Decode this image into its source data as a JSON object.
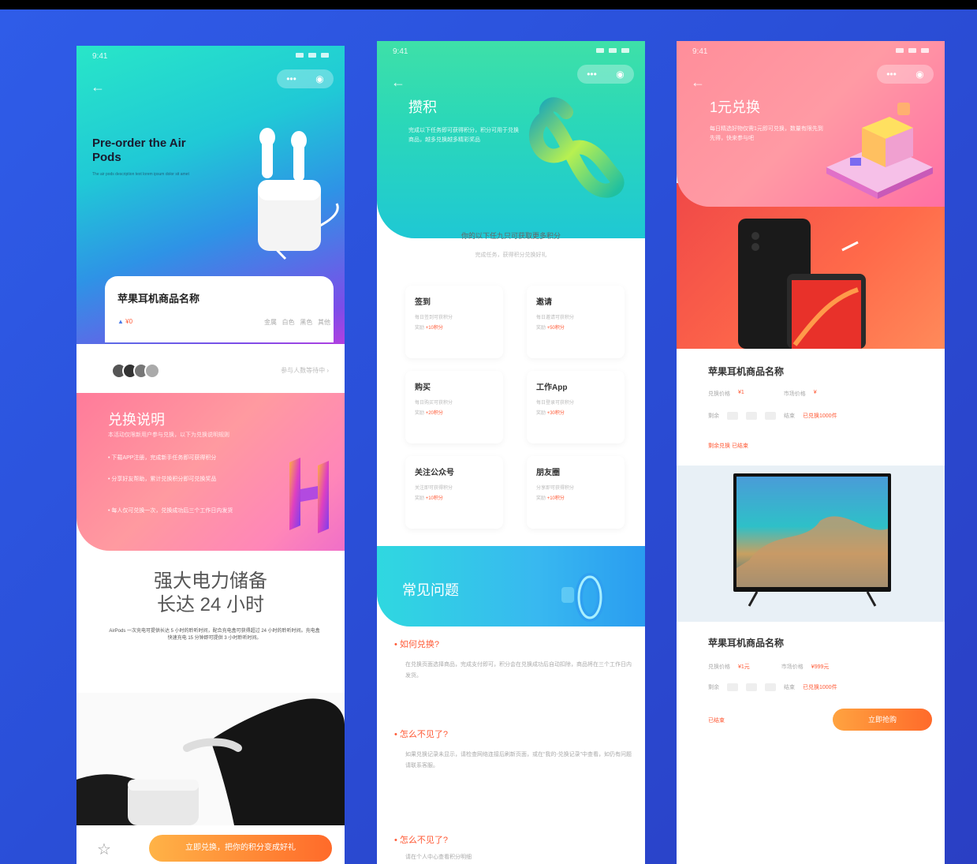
{
  "phone1": {
    "hero_title": "Pre-order the Air Pods",
    "hero_subtitle": "The air pods description text lorem ipsum dolor sit amet",
    "product_name": "苹果耳机商品名称",
    "product_price": "¥0",
    "product_specs": [
      "金属",
      "白色",
      "黑色",
      "其他"
    ],
    "joined_text": "参与人数等待中 ›",
    "rules_title": "兑换说明",
    "rules_subtitle": "本活动仅限新用户参与兑换，以下为兑换说明规则",
    "rules": [
      "• 下载APP注册，完成新手任务即可获得积分",
      "• 分享好友帮助，累计兑换积分即可兑换奖品",
      "• 每人仅可兑换一次，兑换成功后三个工作日内发货"
    ],
    "feature_title_1": "强大电力储备",
    "feature_title_2": "长达 24 小时",
    "feature_body": "AirPods 一次充电可提供长达 5 小时的聆听时间，配合充电盒可获得超过 24 小时的聆听时间。充电盒快速充电 15 分钟即可提供 3 小时聆听时间。",
    "cta": "立即兑换，把你的积分变成好礼",
    "star_icon": "star-icon"
  },
  "phone2": {
    "hero_title": "攒积",
    "hero_text": "完成以下任务即可获得积分，积分可用于兑换商品，越多兑换越多精彩奖品",
    "hint": "你的以下任九只可获取更多积分",
    "hint_sub": "完成任务，获得积分兑换好礼",
    "tasks": [
      {
        "title": "签到",
        "desc": "每日签到可获积分",
        "reward_prefix": "奖励",
        "reward": "+10积分"
      },
      {
        "title": "邀请",
        "desc": "每日邀请可获积分",
        "reward_prefix": "奖励",
        "reward": "+50积分"
      },
      {
        "title": "购买",
        "desc": "每日购买可获积分",
        "reward_prefix": "奖励",
        "reward": "+20积分"
      },
      {
        "title": "工作App",
        "desc": "每日登录可获积分",
        "reward_prefix": "奖励",
        "reward": "+30积分"
      },
      {
        "title": "关注公众号",
        "desc": "关注即可获得积分",
        "reward_prefix": "奖励",
        "reward": "+10积分"
      },
      {
        "title": "朋友圈",
        "desc": "分享即可获得积分",
        "reward_prefix": "奖励",
        "reward": "+10积分"
      }
    ],
    "faq_title": "常见问题",
    "faqs": [
      {
        "q": "• 如何兑换?",
        "a": "在兑换页面选择商品，完成支付即可，积分会在兑换成功后自动扣除，商品将在三个工作日内发货。"
      },
      {
        "q": "• 怎么不见了?",
        "a": "如果兑换记录未显示，请检查网络连接后刷新页面，或在“我的-兑换记录”中查看，如仍有问题请联系客服。"
      },
      {
        "q": "• 怎么不见了?",
        "a": "请在个人中心查看积分明细"
      }
    ]
  },
  "phone3": {
    "hero_title": "1元兑换",
    "hero_text": "每日精选好物仅需1元即可兑换，数量有限先到先得，快来参与吧",
    "product1": {
      "name": "苹果耳机商品名称",
      "label_a": "兑换价格",
      "price_a": "¥1",
      "label_b": "市场价格",
      "price_b": "¥",
      "countdown_label": "剩余",
      "countdown_tail": "结束",
      "stock": "已兑换1000件",
      "sold": "剩余兑换 已结束"
    },
    "product2": {
      "name": "苹果耳机商品名称",
      "label_a": "兑换价格",
      "price_a": "¥1元",
      "label_b": "市场价格",
      "price_b": "¥999元",
      "countdown_label": "剩余",
      "countdown_tail": "结束",
      "stock": "已兑换1000件",
      "ended": "已结束"
    },
    "buy": "立即抢购"
  },
  "colors": {
    "accent_orange": "#ff6a2a",
    "price_red": "#ff5a36",
    "bg_blue": "#2a4fd8"
  }
}
